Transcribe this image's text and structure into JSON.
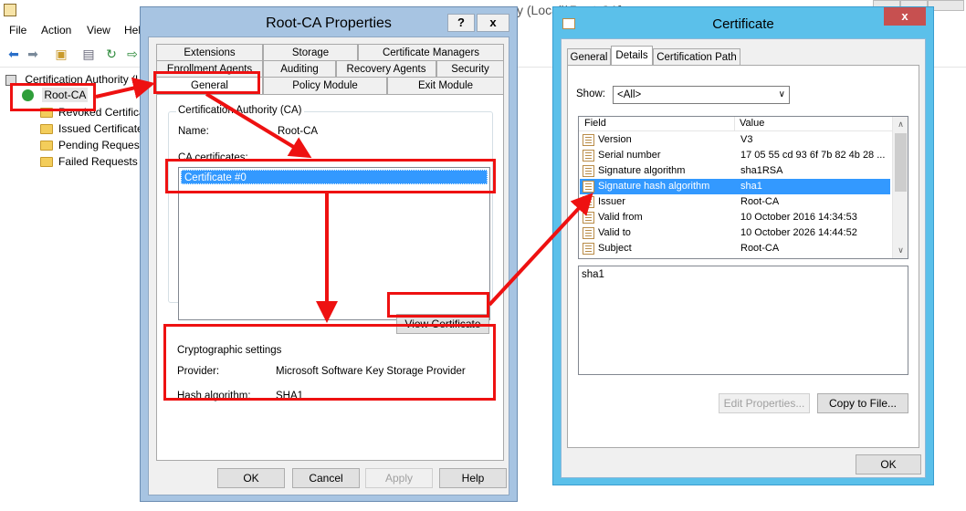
{
  "mmc": {
    "title_fragment": "y (Local)\\Root-CA]",
    "menu": [
      "File",
      "Action",
      "View",
      "Help"
    ],
    "tree": {
      "root_label": "Certification Authority (L",
      "ca_node": "Root-CA",
      "children": [
        "Revoked Certifica",
        "Issued Certificate",
        "Pending Request",
        "Failed Requests"
      ]
    }
  },
  "root_ca_properties": {
    "title": "Root-CA Properties",
    "help_btn": "?",
    "close_btn": "x",
    "tabs_row1": [
      "Extensions",
      "Storage",
      "Certificate Managers"
    ],
    "tabs_row2": [
      "Enrollment Agents",
      "Auditing",
      "Recovery Agents",
      "Security"
    ],
    "tabs_row3": [
      "General",
      "Policy Module",
      "Exit Module"
    ],
    "group_ca_title": "Certification Authority (CA)",
    "name_label": "Name:",
    "name_value": "Root-CA",
    "ca_certs_label": "CA certificates:",
    "ca_certs": [
      "Certificate #0"
    ],
    "view_cert_btn": "View Certificate",
    "crypto_title": "Cryptographic settings",
    "provider_label": "Provider:",
    "provider_value": "Microsoft Software Key Storage Provider",
    "hash_label": "Hash algorithm:",
    "hash_value": "SHA1",
    "buttons": {
      "ok": "OK",
      "cancel": "Cancel",
      "apply": "Apply",
      "help": "Help"
    }
  },
  "certificate": {
    "title": "Certificate",
    "close_btn": "x",
    "tabs": [
      "General",
      "Details",
      "Certification Path"
    ],
    "show_label": "Show:",
    "show_value": "<All>",
    "col_field": "Field",
    "col_value": "Value",
    "rows": [
      {
        "field": "Version",
        "value": "V3"
      },
      {
        "field": "Serial number",
        "value": "17 05 55 cd 93 6f 7b 82 4b 28 ..."
      },
      {
        "field": "Signature algorithm",
        "value": "sha1RSA"
      },
      {
        "field": "Signature hash algorithm",
        "value": "sha1"
      },
      {
        "field": "Issuer",
        "value": "Root-CA"
      },
      {
        "field": "Valid from",
        "value": "10 October 2016 14:34:53"
      },
      {
        "field": "Valid to",
        "value": "10 October 2026 14:44:52"
      },
      {
        "field": "Subject",
        "value": "Root-CA"
      }
    ],
    "selected_row": 3,
    "detail_text": "sha1",
    "edit_props_btn": "Edit Properties...",
    "copy_file_btn": "Copy to File...",
    "ok_btn": "OK"
  },
  "colors": {
    "annotation_red": "#ee1111",
    "selection_blue": "#3399ff",
    "dialog_frame": "#a7c4e2",
    "cert_frame": "#5bc0ea"
  }
}
